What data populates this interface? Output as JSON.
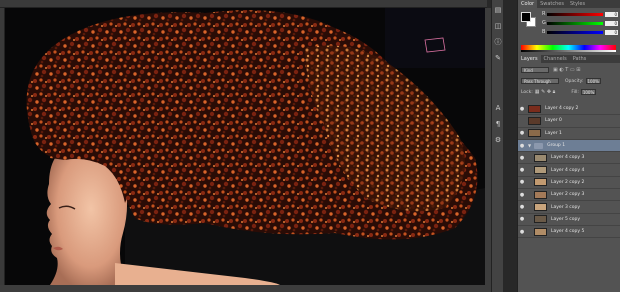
{
  "ruler": {
    "ticks": [
      "",
      "",
      "",
      "",
      "",
      "",
      "",
      "",
      "",
      "",
      "",
      "",
      "",
      "",
      ""
    ]
  },
  "color_panel": {
    "tabs": [
      "Color",
      "Swatches",
      "Styles"
    ],
    "channels": [
      {
        "label": "R",
        "value": "0"
      },
      {
        "label": "G",
        "value": "0"
      },
      {
        "label": "B",
        "value": "0"
      }
    ],
    "foreground": "#000000",
    "background": "#ffffff"
  },
  "layers_panel": {
    "tabs": [
      "Layers",
      "Channels",
      "Paths"
    ],
    "kind": "Kind",
    "blend_mode": "Pass Through",
    "opacity_label": "Opacity:",
    "opacity": "100%",
    "lock_label": "Lock:",
    "fill_label": "Fill:",
    "fill": "100%",
    "layers": [
      {
        "name": "Layer 4 copy 2",
        "visible": true,
        "indent": false,
        "type": "layer",
        "thumb": "#7a2c1c"
      },
      {
        "name": "Layer 0",
        "visible": false,
        "indent": false,
        "type": "layer",
        "thumb": "#5a3a2a"
      },
      {
        "name": "Layer 1",
        "visible": true,
        "indent": false,
        "type": "layer",
        "thumb": "#8a6a4a"
      },
      {
        "name": "Group 1",
        "visible": true,
        "indent": false,
        "type": "group",
        "thumb": "#8b98ad"
      },
      {
        "name": "Layer 4 copy 3",
        "visible": true,
        "indent": true,
        "type": "layer",
        "thumb": "#9a8a70"
      },
      {
        "name": "Layer 4 copy 4",
        "visible": true,
        "indent": true,
        "type": "layer",
        "thumb": "#b09a7a"
      },
      {
        "name": "Layer 2 copy 2",
        "visible": true,
        "indent": true,
        "type": "layer",
        "thumb": "#c29a70"
      },
      {
        "name": "Layer 2 copy 3",
        "visible": true,
        "indent": true,
        "type": "layer",
        "thumb": "#a47a58"
      },
      {
        "name": "Layer 3 copy",
        "visible": true,
        "indent": true,
        "type": "layer",
        "thumb": "#c8a47c"
      },
      {
        "name": "Layer 5 copy",
        "visible": true,
        "indent": true,
        "type": "layer",
        "thumb": "#6a5a48"
      },
      {
        "name": "Layer 4 copy 5",
        "visible": true,
        "indent": true,
        "type": "layer",
        "thumb": "#b08c66"
      }
    ]
  }
}
